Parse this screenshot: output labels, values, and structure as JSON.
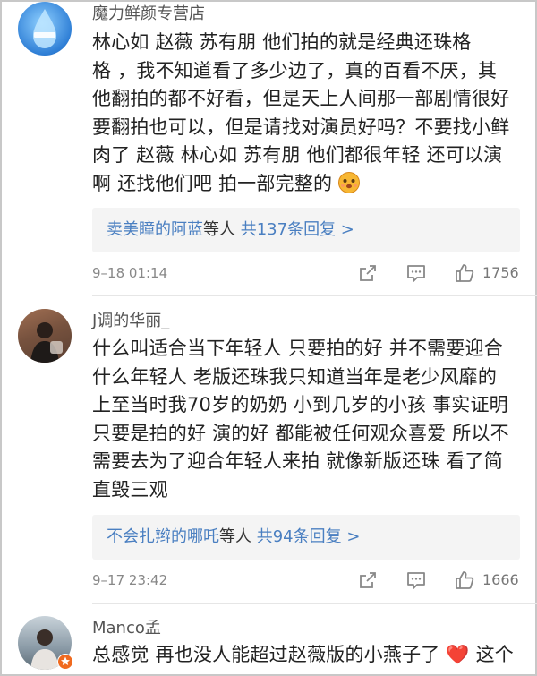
{
  "comments": [
    {
      "author": "魔力鲜颜专营店",
      "lines": [
        "林心如 赵薇 苏有朋 他们拍的就是经典还珠格",
        "格 ，我不知道看了多少边了，真的百看不厌，其",
        "他翻拍的都不好看，但是天上人间那一部剧情很好",
        "要翻拍也可以，但是请找对演员好吗？不要找小鲜",
        "肉了 赵薇 林心如 苏有朋 他们都很年轻 还可以演",
        "啊 还找他们吧 拍一部完整的"
      ],
      "replies": {
        "user": "卖美瞳的阿蓝",
        "suffix": "等人",
        "count": "共137条回复 >"
      },
      "time": "9–18 01:14",
      "likes": "1756",
      "avatar_color": "#2f7fd6"
    },
    {
      "author": "J调的华丽_",
      "lines": [
        "什么叫适合当下年轻人 只要拍的好 并不需要迎合",
        "什么年轻人 老版还珠我只知道当年是老少风靡的",
        "上至当时我70岁的奶奶 小到几岁的小孩 事实证明",
        "只要是拍的好 演的好 都能被任何观众喜爱 所以不",
        "需要去为了迎合年轻人来拍 就像新版还珠 看了简",
        "直毁三观"
      ],
      "replies": {
        "user": "不会扎辫的哪吒",
        "suffix": "等人",
        "count": "共94条回复 >"
      },
      "time": "9–17 23:42",
      "likes": "1666",
      "avatar_color": "#5a3a2a"
    },
    {
      "author": "Manco孟",
      "lines": [
        "总感觉 再也没人能超过赵薇版的小燕子了 ❤️ 这个"
      ],
      "avatar_color": "#8a9aa6"
    }
  ],
  "icons": [
    "forward-icon",
    "comment-icon",
    "like-icon",
    "heart-emoji",
    "blush-emoji",
    "verified-badge"
  ]
}
